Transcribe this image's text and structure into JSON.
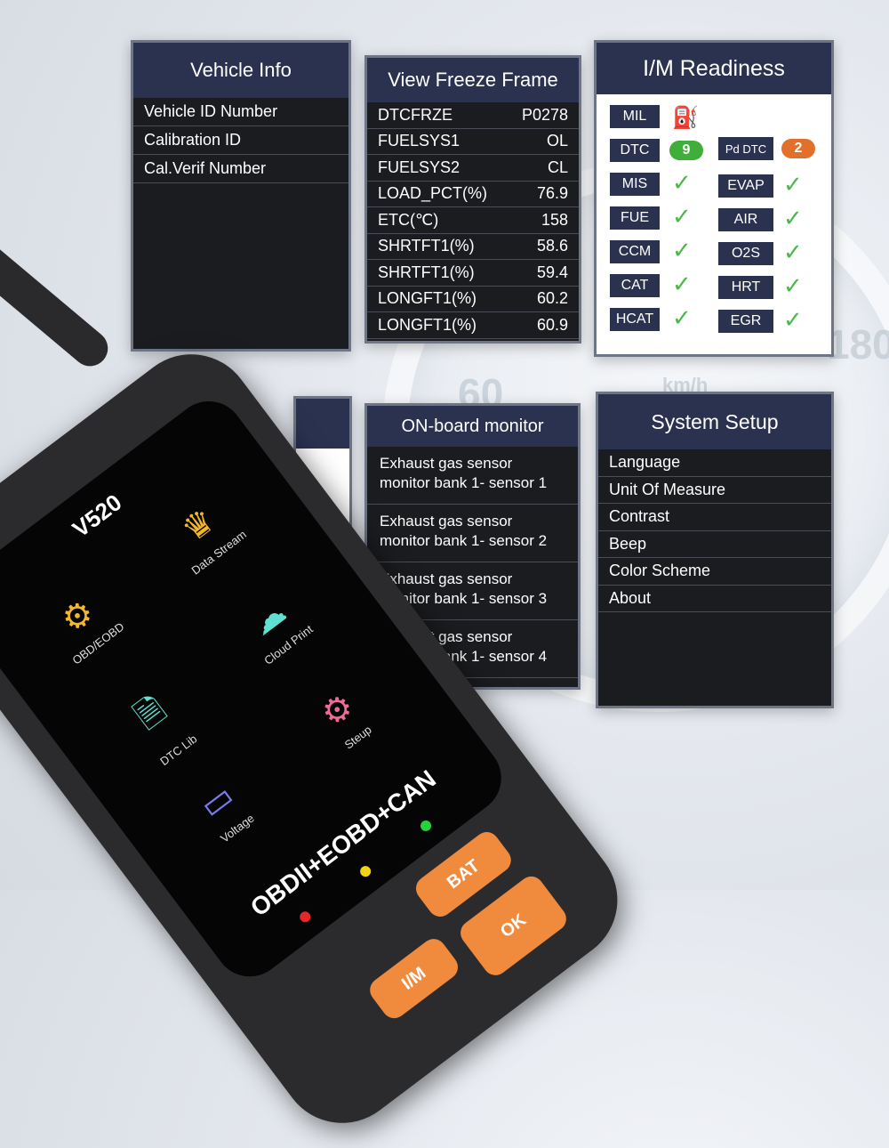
{
  "vehicle_info": {
    "title": "Vehicle Info",
    "items": [
      "Vehicle ID Number",
      "Calibration ID",
      "Cal.Verif Number"
    ]
  },
  "freeze_frame": {
    "title": "View Freeze Frame",
    "rows": [
      {
        "label": "DTCFRZE",
        "value": "P0278"
      },
      {
        "label": "FUELSYS1",
        "value": "OL"
      },
      {
        "label": "FUELSYS2",
        "value": "CL"
      },
      {
        "label": "LOAD_PCT(%)",
        "value": "76.9"
      },
      {
        "label": "ETC(℃)",
        "value": "158"
      },
      {
        "label": "SHRTFT1(%)",
        "value": "58.6"
      },
      {
        "label": "SHRTFT1(%)",
        "value": "59.4"
      },
      {
        "label": "LONGFT1(%)",
        "value": "60.2"
      },
      {
        "label": "LONGFT1(%)",
        "value": "60.9"
      }
    ]
  },
  "readiness": {
    "title": "I/M Readiness",
    "mil": "MIL",
    "dtc": "DTC",
    "dtc_count": "9",
    "pd_dtc": "Pd DTC",
    "pd_dtc_count": "2",
    "left": [
      "MIS",
      "FUE",
      "CCM",
      "CAT",
      "HCAT"
    ],
    "right": [
      "EVAP",
      "AIR",
      "O2S",
      "HRT",
      "EGR"
    ],
    "check": "✓",
    "colors": {
      "ok": "#4cb84a",
      "dtc": "#3fae3a",
      "pd": "#e2702a",
      "engine": "#2f6fd0"
    }
  },
  "monitor": {
    "title": "ON-board monitor",
    "items": [
      [
        "Exhaust gas sensor",
        "monitor bank 1- sensor 1"
      ],
      [
        "Exhaust gas sensor",
        "monitor bank 1- sensor 2"
      ],
      [
        "Exhaust gas sensor",
        "monitor bank 1- sensor 3"
      ],
      [
        "Exhaust gas sensor",
        "monitor bank 1- sensor 4"
      ]
    ]
  },
  "setup": {
    "title": "System Setup",
    "items": [
      "Language",
      "Unit Of Measure",
      "Contrast",
      "Beep",
      "Color Scheme",
      "About"
    ]
  },
  "gauge": {
    "labels": [
      "180",
      "60",
      "km/h"
    ]
  },
  "device": {
    "model": "V520",
    "protocols": "OBDII+EOBD+CAN",
    "apps": [
      {
        "label": "Data Stream",
        "icon": "chart-icon"
      },
      {
        "label": "OBD/EOBD",
        "icon": "engine-icon"
      },
      {
        "label": "Cloud Print",
        "icon": "cloud-icon"
      },
      {
        "label": "DTC Lib",
        "icon": "document-search-icon"
      },
      {
        "label": "Steup",
        "icon": "gear-icon"
      },
      {
        "label": "Voltage",
        "icon": "battery-icon"
      }
    ],
    "buttons": {
      "bat": "BAT",
      "im": "I/M",
      "ok": "OK"
    },
    "leds": {
      "green": "#22d43a",
      "yellow": "#f3d21a",
      "red": "#e8262a"
    },
    "accent": "#f08a3c"
  }
}
